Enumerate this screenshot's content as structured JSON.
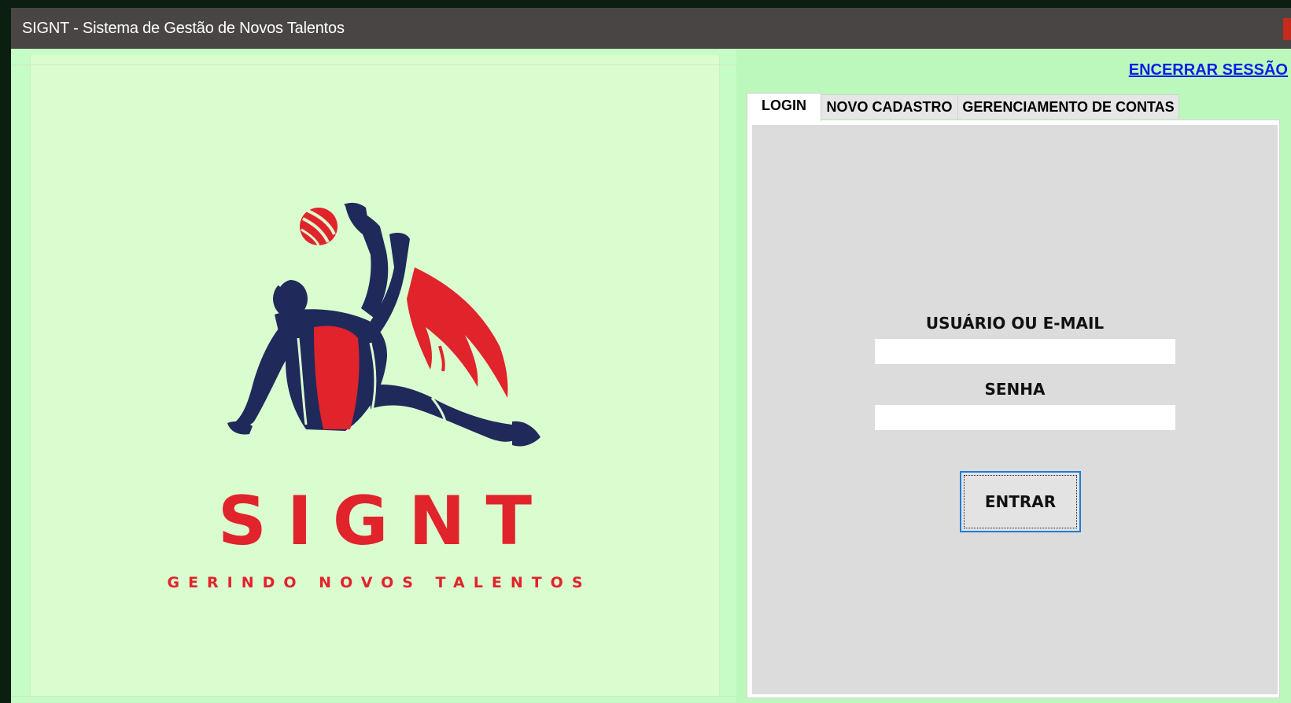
{
  "window": {
    "title": "SIGNT - Sistema de Gestão de Novos Talentos"
  },
  "brand": {
    "name": "SIGNT",
    "tagline": "GERINDO NOVOS TALENTOS",
    "logo_icon": "bicycle-kick-footballer-logo",
    "colors": {
      "red": "#e1232b",
      "navy": "#1f2a5a"
    }
  },
  "header": {
    "logout_label": "ENCERRAR SESSÃO"
  },
  "tabs": [
    {
      "label": "LOGIN",
      "active": true
    },
    {
      "label": "NOVO CADASTRO",
      "active": false
    },
    {
      "label": "GERENCIAMENTO DE CONTAS",
      "active": false
    }
  ],
  "login": {
    "user_label": "USUÁRIO OU E-MAIL",
    "user_value": "",
    "password_label": "SENHA",
    "password_value": "",
    "submit_label": "ENTRAR"
  },
  "colors": {
    "window_bg": "#bcf8bc",
    "titlebar_bg": "#4a4545",
    "link": "#0a1fe6",
    "button_focus": "#1e7bd6"
  }
}
